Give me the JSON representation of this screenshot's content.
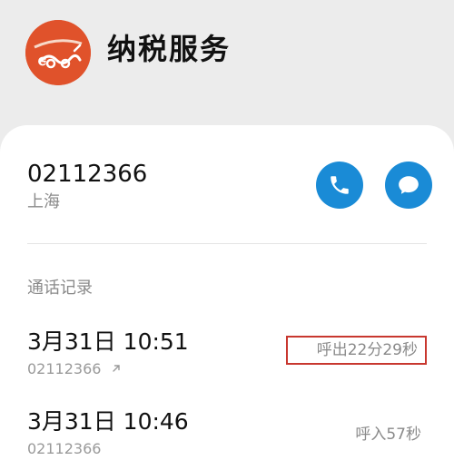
{
  "header": {
    "title": "纳税服务",
    "logo_icon": "tax-service-logo"
  },
  "contact": {
    "number": "02112366",
    "location": "上海",
    "call_icon": "phone-icon",
    "message_icon": "chat-bubble-icon"
  },
  "call_log": {
    "title": "通话记录",
    "entries": [
      {
        "datetime": "3月31日 10:51",
        "number": "02112366",
        "direction_icon": "outgoing-arrow-icon",
        "detail": "呼出22分29秒"
      },
      {
        "datetime": "3月31日 10:46",
        "number": "02112366",
        "detail": "呼入57秒"
      }
    ]
  },
  "colors": {
    "accent": "#1a8bd6",
    "logo": "#e0522b",
    "highlight_box": "#c8372f",
    "background": "#ececec"
  }
}
